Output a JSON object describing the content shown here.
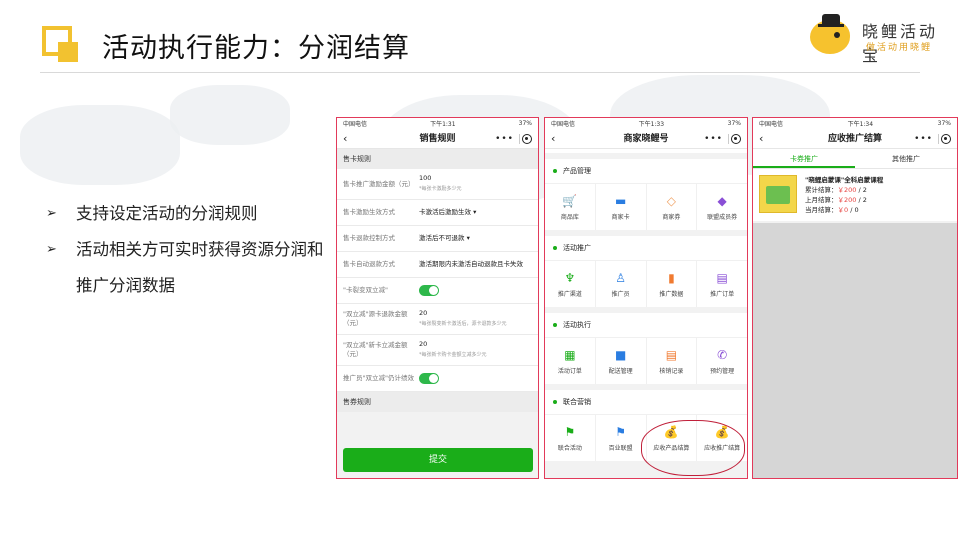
{
  "slide": {
    "title": "活动执行能力：分润结算",
    "logo_name": "晓鲤活动宝",
    "logo_tagline": "做活动用晓鲤",
    "bullets": [
      "支持设定活动的分润规则",
      "活动相关方可实时获得资源分润和推广分润数据"
    ],
    "bullet_marker": "➢"
  },
  "phone1": {
    "status": {
      "carrier": "中国电信",
      "time": "下午1:31",
      "battery": "37%"
    },
    "nav_title": "销售规则",
    "section1": "售卡规则",
    "rows": [
      {
        "label": "售卡推广激励金额（元）",
        "value": "100",
        "hint": "*每张卡激励多少元"
      },
      {
        "label": "售卡激励生效方式",
        "value": "卡激活后激励生效 ▾",
        "hint": ""
      },
      {
        "label": "售卡退款控制方式",
        "value": "激活后不可退款 ▾",
        "hint": ""
      },
      {
        "label": "售卡自动退款方式",
        "value": "激活期限内未激活自动退款且卡失效",
        "hint": ""
      },
      {
        "label": "\"卡裂变双立减\"",
        "value": "",
        "hint": "",
        "toggle": true
      },
      {
        "label": "\"双立减\"源卡退款金额（元）",
        "value": "20",
        "hint": "*每张裂变新卡激活后，源卡退款多少元"
      },
      {
        "label": "\"双立减\"新卡立减金额（元）",
        "value": "20",
        "hint": "*每张新卡购卡金额立减多少元"
      },
      {
        "label": "推广员\"双立减\"仍计绩效",
        "value": "",
        "hint": "",
        "toggle": true
      }
    ],
    "section2": "售券规则",
    "submit": "提交"
  },
  "phone2": {
    "status": {
      "carrier": "中国电信",
      "time": "下午1:33",
      "battery": "37%"
    },
    "nav_title": "商家晓鲤号",
    "groups": [
      {
        "title": "产品管理",
        "items": [
          {
            "label": "商品库",
            "icon": "cart-icon",
            "glyph": "🛒",
            "color": "#1aad19"
          },
          {
            "label": "商家卡",
            "icon": "card-icon",
            "glyph": "▬",
            "color": "#2a7de1"
          },
          {
            "label": "商家券",
            "icon": "coupon-icon",
            "glyph": "◇",
            "color": "#f0a060"
          },
          {
            "label": "联盟成员券",
            "icon": "tag-icon",
            "glyph": "◆",
            "color": "#8a4fd6"
          }
        ]
      },
      {
        "title": "活动推广",
        "items": [
          {
            "label": "推广渠道",
            "icon": "channel-icon",
            "glyph": "♆",
            "color": "#1aad19"
          },
          {
            "label": "推广员",
            "icon": "user-icon",
            "glyph": "♙",
            "color": "#2a7de1"
          },
          {
            "label": "推广数据",
            "icon": "bar-chart-icon",
            "glyph": "▮",
            "color": "#f07a30"
          },
          {
            "label": "推广订单",
            "icon": "document-icon",
            "glyph": "▤",
            "color": "#8a4fd6"
          }
        ]
      },
      {
        "title": "活动执行",
        "items": [
          {
            "label": "活动订单",
            "icon": "grid-icon",
            "glyph": "▦",
            "color": "#1aad19"
          },
          {
            "label": "配送管理",
            "icon": "truck-icon",
            "glyph": "■",
            "color": "#2a7de1"
          },
          {
            "label": "核销记录",
            "icon": "record-icon",
            "glyph": "▤",
            "color": "#f07a30"
          },
          {
            "label": "预约管理",
            "icon": "phone-icon",
            "glyph": "✆",
            "color": "#8a4fd6"
          }
        ]
      },
      {
        "title": "联合营销",
        "items": [
          {
            "label": "联合活动",
            "icon": "flag-icon",
            "glyph": "⚑",
            "color": "#1aad19"
          },
          {
            "label": "百业联盟",
            "icon": "flag-icon",
            "glyph": "⚑",
            "color": "#2a7de1"
          },
          {
            "label": "应收产品结算",
            "icon": "money-bag-icon",
            "glyph": "💰",
            "color": "#f07a30"
          },
          {
            "label": "应收推广结算",
            "icon": "money-bag-icon",
            "glyph": "💰",
            "color": "#8a4fd6"
          }
        ]
      }
    ]
  },
  "phone3": {
    "status": {
      "carrier": "中国电信",
      "time": "下午1:34",
      "battery": "37%"
    },
    "nav_title": "应收推广结算",
    "tabs": [
      "卡券推广",
      "其他推广"
    ],
    "course": {
      "title": "\"晓鲤启蒙课\"全科启蒙课程",
      "lines": [
        {
          "label": "累计结算：",
          "amount": "￥200",
          "count": "2"
        },
        {
          "label": "上月结算：",
          "amount": "￥200",
          "count": "2"
        },
        {
          "label": "当月结算：",
          "amount": "￥0",
          "count": "0"
        }
      ]
    }
  }
}
